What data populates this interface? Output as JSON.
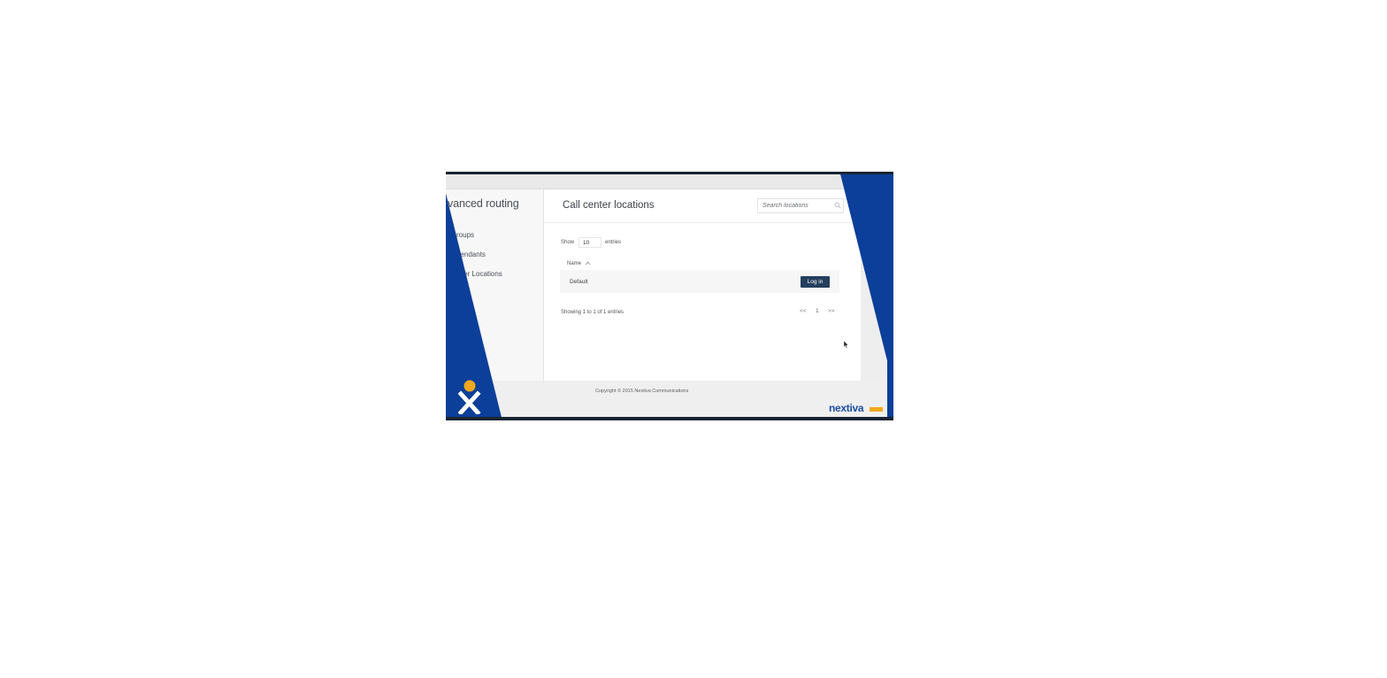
{
  "sidebar": {
    "title": "vanced routing",
    "items": [
      {
        "label": "roups"
      },
      {
        "label": "ttendants"
      },
      {
        "label": "ter Locations"
      }
    ]
  },
  "main": {
    "title": "Call center locations",
    "search": {
      "placeholder": "Search locations",
      "icon": "search-icon"
    },
    "length": {
      "show_label": "Show",
      "value": "10",
      "entries_label": "entries"
    },
    "table": {
      "columns": [
        {
          "label": "Name",
          "sort": "ascending"
        }
      ],
      "rows": [
        {
          "name": "Default",
          "action_label": "Log in"
        }
      ]
    },
    "info": "Showing 1 to 1 of 1 entries",
    "pagination": {
      "first": "<<",
      "current": "1",
      "last": ">>"
    }
  },
  "footer": {
    "copyright": "Copyright © 2015 Nextiva Communications"
  },
  "branding": {
    "logo_text": "nextiva",
    "accent": "#f0a81e",
    "brand_blue": "#0c3f99"
  }
}
